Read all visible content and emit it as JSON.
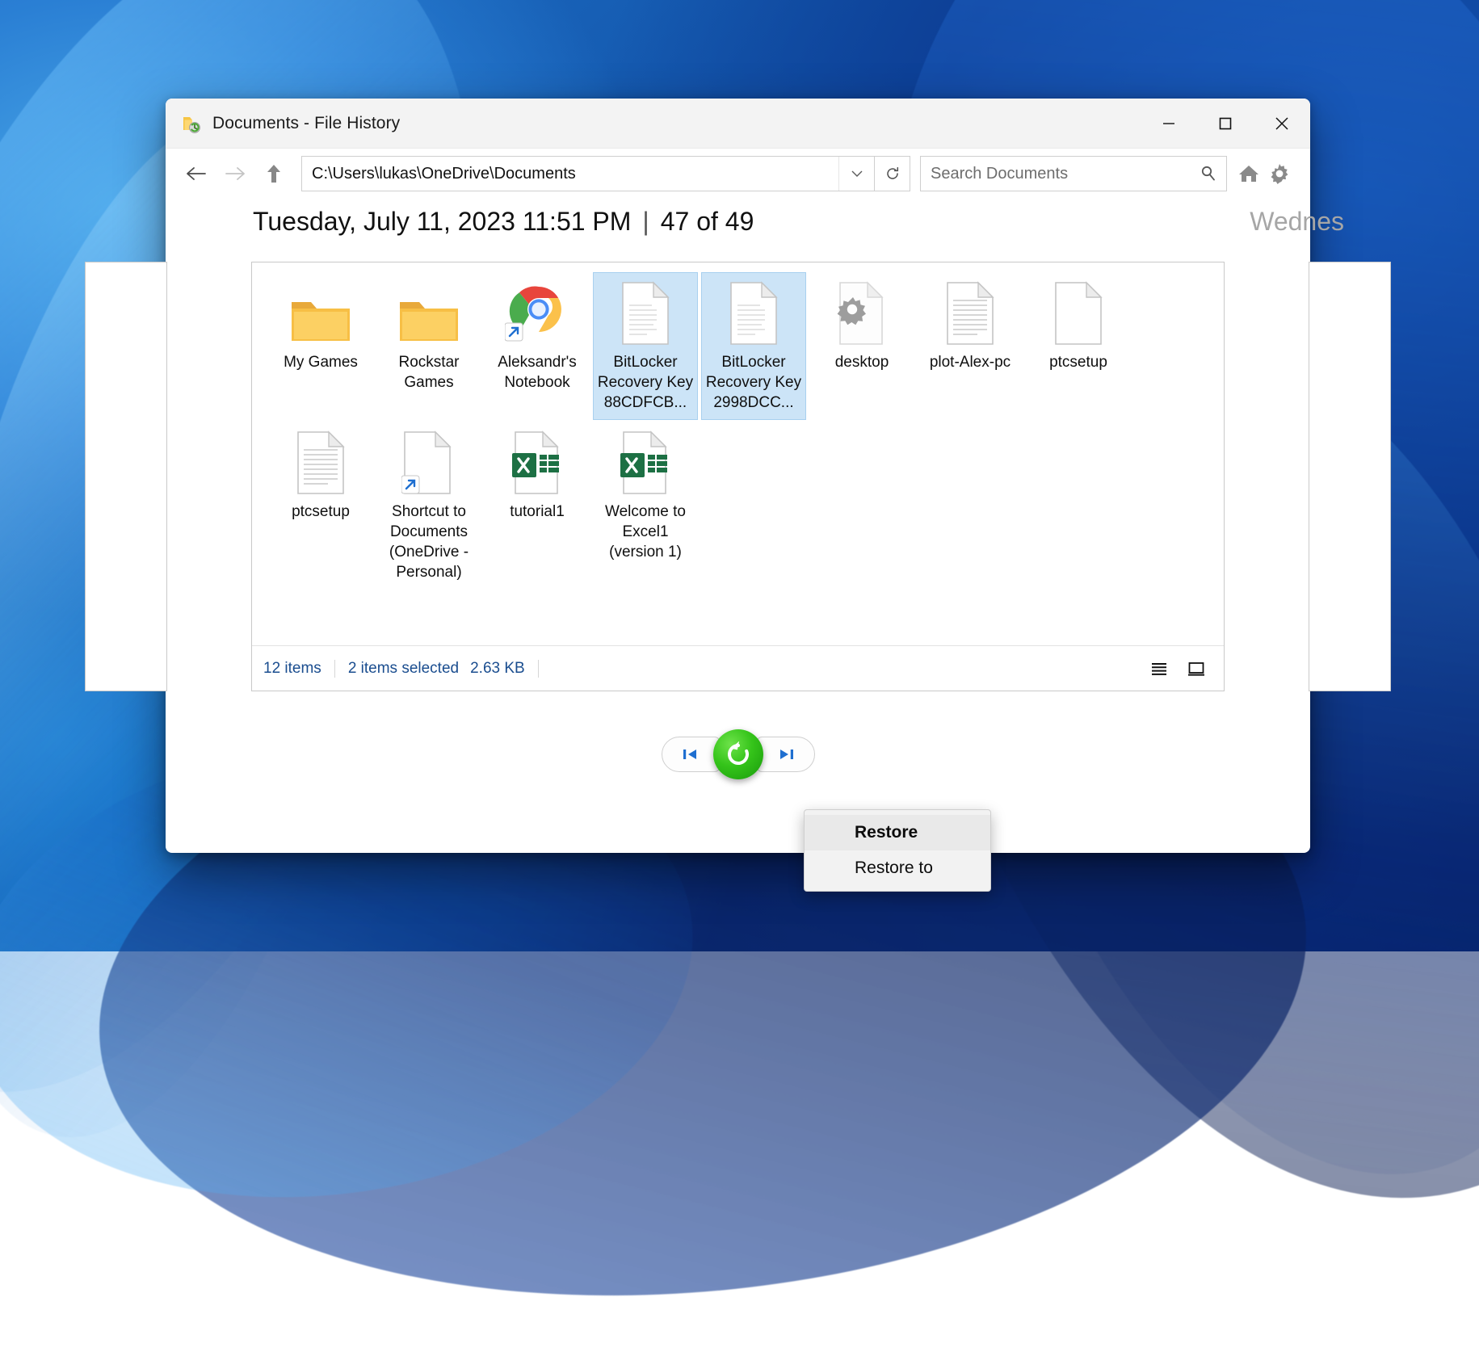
{
  "window": {
    "title": "Documents - File History",
    "title_icon": "folder-clock-icon",
    "minimize_label": "—",
    "maximize_label": "□",
    "close_label": "✕"
  },
  "toolbar": {
    "back_icon": "arrow-left-icon",
    "forward_icon": "arrow-right-icon",
    "up_icon": "arrow-up-icon",
    "address_value": "C:\\Users\\lukas\\OneDrive\\Documents",
    "address_chevron_icon": "chevron-down-icon",
    "refresh_icon": "refresh-icon",
    "search_placeholder": "Search Documents",
    "search_icon": "search-icon",
    "home_icon": "home-icon",
    "settings_icon": "gear-icon"
  },
  "header": {
    "date": "Tuesday, July 11, 2023 11:51 PM",
    "separator": "|",
    "counter": "47 of 49",
    "next_label": "Wednes"
  },
  "files": [
    {
      "name": "My Games",
      "icon": "folder-icon",
      "selected": false
    },
    {
      "name": "Rockstar Games",
      "icon": "folder-icon",
      "selected": false
    },
    {
      "name": "Aleksandr's Notebook",
      "icon": "chrome-shortcut-icon",
      "selected": false
    },
    {
      "name": "BitLocker Recovery Key 88CDFCB...",
      "icon": "text-file-icon",
      "selected": true
    },
    {
      "name": "BitLocker Recovery Key 2998DCC...",
      "icon": "text-file-icon",
      "selected": true
    },
    {
      "name": "desktop",
      "icon": "settings-file-icon",
      "selected": false
    },
    {
      "name": "plot-Alex-pc",
      "icon": "text-lines-file-icon",
      "selected": false
    },
    {
      "name": "ptcsetup",
      "icon": "blank-file-icon",
      "selected": false
    },
    {
      "name": "ptcsetup",
      "icon": "text-lines-file-icon",
      "selected": false
    },
    {
      "name": "Shortcut to Documents (OneDrive - Personal)",
      "icon": "file-shortcut-icon",
      "selected": false
    },
    {
      "name": "tutorial1",
      "icon": "excel-file-icon",
      "selected": false
    },
    {
      "name": "Welcome to Excel1 (version 1)",
      "icon": "excel-file-icon",
      "selected": false
    }
  ],
  "status": {
    "items_count": "12 items",
    "selection": "2 items selected",
    "size": "2.63 KB",
    "list_view_icon": "list-view-icon",
    "tile_view_icon": "tile-view-icon"
  },
  "bottom_nav": {
    "previous_icon": "previous-version-icon",
    "restore_icon": "restore-circular-arrow-icon",
    "next_icon": "next-version-icon"
  },
  "context_menu": {
    "items": [
      {
        "label": "Restore",
        "highlighted": true
      },
      {
        "label": "Restore to",
        "highlighted": false
      }
    ]
  },
  "colors": {
    "selection_blue": "#cce4f7",
    "status_text": "#1a4d8f",
    "restore_green": "#35c41a",
    "nav_blue": "#1f6fd0"
  }
}
